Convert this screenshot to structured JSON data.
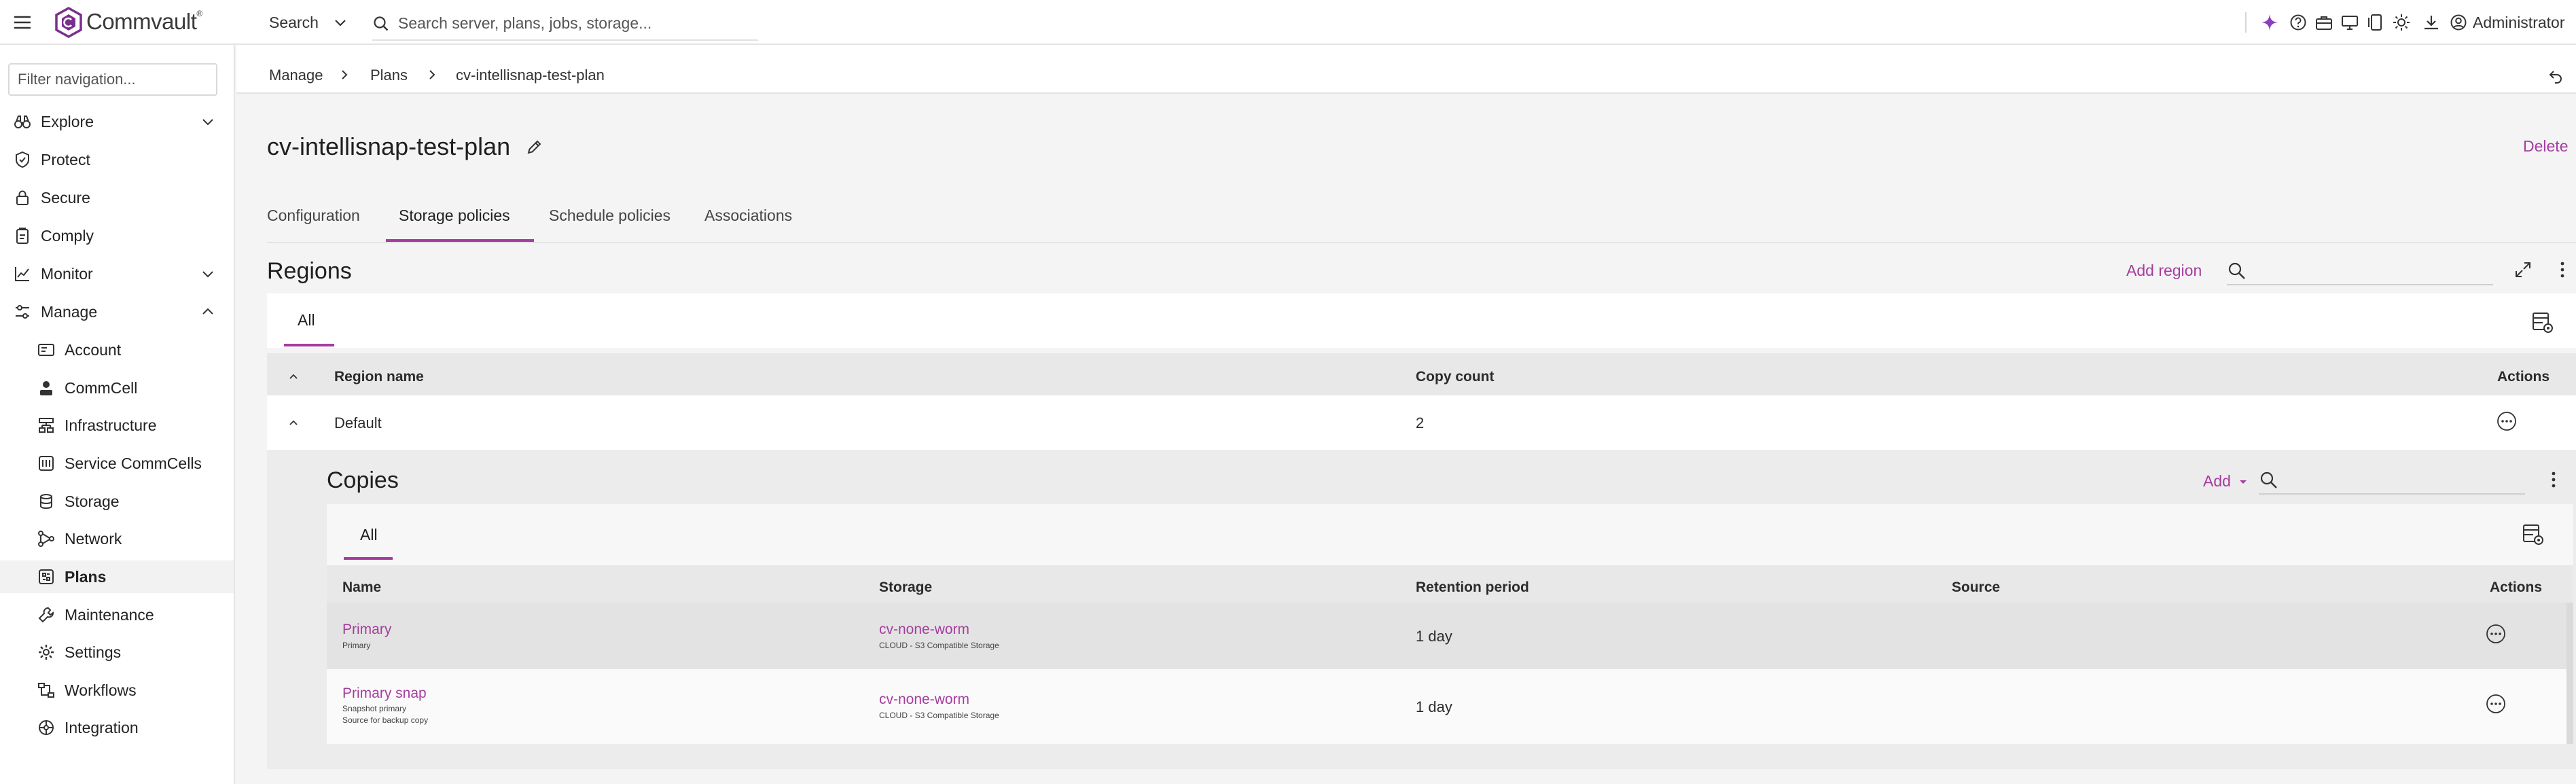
{
  "topbar": {
    "brand": "Commvault",
    "brand_mark": "®",
    "search_scope": "Search",
    "search_placeholder": "Search server, plans, jobs, storage...",
    "user": "Administrator",
    "icons": [
      "sparkle-icon",
      "help-icon",
      "briefcase-icon",
      "monitor-icon",
      "phone-icon",
      "theme-icon",
      "download-icon",
      "user-icon"
    ]
  },
  "sidebar": {
    "filter_placeholder": "Filter navigation...",
    "items": [
      {
        "label": "Explore",
        "icon": "binoculars-icon"
      },
      {
        "label": "Protect",
        "icon": "shield-check-icon"
      },
      {
        "label": "Secure",
        "icon": "lock-icon"
      },
      {
        "label": "Comply",
        "icon": "clipboard-icon"
      },
      {
        "label": "Monitor",
        "icon": "chart-line-icon"
      },
      {
        "label": "Manage",
        "icon": "sliders-icon"
      }
    ],
    "manage_items": [
      {
        "label": "Account",
        "icon": "id-card-icon"
      },
      {
        "label": "CommCell",
        "icon": "user-server-icon"
      },
      {
        "label": "Infrastructure",
        "icon": "infrastructure-icon"
      },
      {
        "label": "Service CommCells",
        "icon": "service-commcell-icon"
      },
      {
        "label": "Storage",
        "icon": "database-icon"
      },
      {
        "label": "Network",
        "icon": "network-icon"
      },
      {
        "label": "Plans",
        "icon": "plans-icon"
      },
      {
        "label": "Maintenance",
        "icon": "maintenance-icon"
      },
      {
        "label": "Settings",
        "icon": "gear-icon"
      },
      {
        "label": "Workflows",
        "icon": "workflow-icon"
      },
      {
        "label": "Integration",
        "icon": "integration-icon"
      }
    ]
  },
  "breadcrumb": [
    "Manage",
    "Plans",
    "cv-intellisnap-test-plan"
  ],
  "page": {
    "title": "cv-intellisnap-test-plan",
    "delete_label": "Delete",
    "tabs": [
      "Configuration",
      "Storage policies",
      "Schedule policies",
      "Associations"
    ]
  },
  "regions": {
    "title": "Regions",
    "add_label": "Add region",
    "tab_all": "All",
    "columns": {
      "name": "Region name",
      "count": "Copy count",
      "actions": "Actions"
    },
    "rows": [
      {
        "name": "Default",
        "count": "2"
      }
    ]
  },
  "copies": {
    "title": "Copies",
    "add_label": "Add",
    "tab_all": "All",
    "columns": {
      "name": "Name",
      "storage": "Storage",
      "retention": "Retention period",
      "source": "Source",
      "actions": "Actions"
    },
    "rows": [
      {
        "name": "Primary",
        "sub1": "Primary",
        "sub2": "",
        "storage": "cv-none-worm",
        "storage_sub": "CLOUD - S3 Compatible Storage",
        "retention": "1 day",
        "source": ""
      },
      {
        "name": "Primary snap",
        "sub1": "Snapshot primary",
        "sub2": "Source for backup copy",
        "storage": "cv-none-worm",
        "storage_sub": "CLOUD - S3 Compatible Storage",
        "retention": "1 day",
        "source": ""
      }
    ]
  },
  "colors": {
    "accent": "#a63c9e",
    "sidebar_active": "#f2f2f2"
  }
}
